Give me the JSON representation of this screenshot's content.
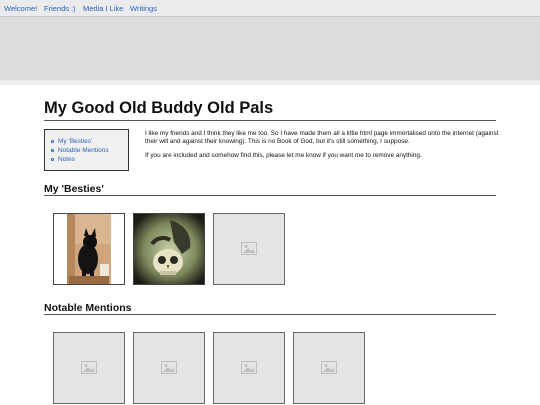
{
  "nav": {
    "items": [
      {
        "label": "Welcome!"
      },
      {
        "label": "Friends :)"
      },
      {
        "label": "Media I Like"
      },
      {
        "label": "Writings"
      }
    ]
  },
  "page": {
    "title": "My Good Old Buddy Old Pals"
  },
  "toc": {
    "items": [
      {
        "label": "My 'Besties'"
      },
      {
        "label": "Notable Mentions"
      },
      {
        "label": "Notes"
      }
    ]
  },
  "intro": {
    "paragraph_1": "I like my friends and I think they like me too. So I have made them all a little html page immortalised onto the internet (against their will and against their knowing). This is no Book of God, but it's still something, I suppose.",
    "paragraph_2": "If you are included and somehow find this, please let me know if you want me to remove anything."
  },
  "sections": {
    "besties": {
      "heading": "My 'Besties'",
      "cards": [
        {
          "kind": "photo",
          "icon": "dog-photo"
        },
        {
          "kind": "photo",
          "icon": "skull-photo"
        },
        {
          "kind": "placeholder",
          "icon": "image-placeholder-icon"
        }
      ]
    },
    "notable": {
      "heading": "Notable Mentions",
      "cards": [
        {
          "kind": "placeholder",
          "icon": "image-placeholder-icon"
        },
        {
          "kind": "placeholder",
          "icon": "image-placeholder-icon"
        },
        {
          "kind": "placeholder",
          "icon": "image-placeholder-icon"
        },
        {
          "kind": "placeholder",
          "icon": "image-placeholder-icon"
        }
      ]
    }
  },
  "colors": {
    "link": "#2a64b5",
    "banner": "#dcdcdc",
    "nav_bg": "#ebebed"
  }
}
